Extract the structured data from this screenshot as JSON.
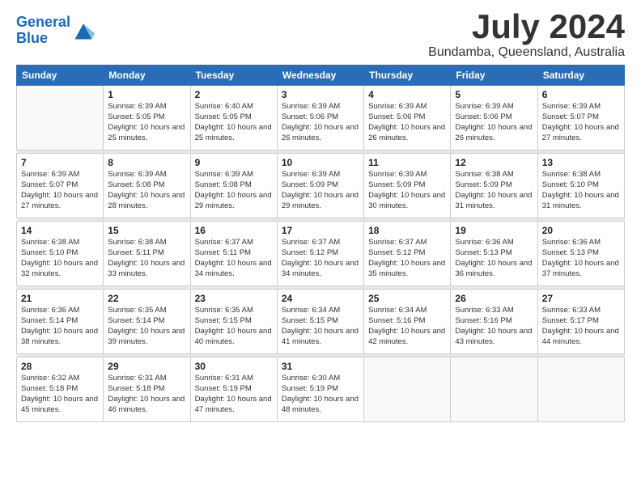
{
  "header": {
    "logo_line1": "General",
    "logo_line2": "Blue",
    "title": "July 2024",
    "subtitle": "Bundamba, Queensland, Australia"
  },
  "calendar": {
    "days": [
      "Sunday",
      "Monday",
      "Tuesday",
      "Wednesday",
      "Thursday",
      "Friday",
      "Saturday"
    ],
    "weeks": [
      [
        {
          "date": "",
          "info": ""
        },
        {
          "date": "1",
          "info": "Sunrise: 6:39 AM\nSunset: 5:05 PM\nDaylight: 10 hours\nand 25 minutes."
        },
        {
          "date": "2",
          "info": "Sunrise: 6:40 AM\nSunset: 5:05 PM\nDaylight: 10 hours\nand 25 minutes."
        },
        {
          "date": "3",
          "info": "Sunrise: 6:39 AM\nSunset: 5:06 PM\nDaylight: 10 hours\nand 26 minutes."
        },
        {
          "date": "4",
          "info": "Sunrise: 6:39 AM\nSunset: 5:06 PM\nDaylight: 10 hours\nand 26 minutes."
        },
        {
          "date": "5",
          "info": "Sunrise: 6:39 AM\nSunset: 5:06 PM\nDaylight: 10 hours\nand 26 minutes."
        },
        {
          "date": "6",
          "info": "Sunrise: 6:39 AM\nSunset: 5:07 PM\nDaylight: 10 hours\nand 27 minutes."
        }
      ],
      [
        {
          "date": "7",
          "info": "Sunrise: 6:39 AM\nSunset: 5:07 PM\nDaylight: 10 hours\nand 27 minutes."
        },
        {
          "date": "8",
          "info": "Sunrise: 6:39 AM\nSunset: 5:08 PM\nDaylight: 10 hours\nand 28 minutes."
        },
        {
          "date": "9",
          "info": "Sunrise: 6:39 AM\nSunset: 5:08 PM\nDaylight: 10 hours\nand 29 minutes."
        },
        {
          "date": "10",
          "info": "Sunrise: 6:39 AM\nSunset: 5:09 PM\nDaylight: 10 hours\nand 29 minutes."
        },
        {
          "date": "11",
          "info": "Sunrise: 6:39 AM\nSunset: 5:09 PM\nDaylight: 10 hours\nand 30 minutes."
        },
        {
          "date": "12",
          "info": "Sunrise: 6:38 AM\nSunset: 5:09 PM\nDaylight: 10 hours\nand 31 minutes."
        },
        {
          "date": "13",
          "info": "Sunrise: 6:38 AM\nSunset: 5:10 PM\nDaylight: 10 hours\nand 31 minutes."
        }
      ],
      [
        {
          "date": "14",
          "info": "Sunrise: 6:38 AM\nSunset: 5:10 PM\nDaylight: 10 hours\nand 32 minutes."
        },
        {
          "date": "15",
          "info": "Sunrise: 6:38 AM\nSunset: 5:11 PM\nDaylight: 10 hours\nand 33 minutes."
        },
        {
          "date": "16",
          "info": "Sunrise: 6:37 AM\nSunset: 5:11 PM\nDaylight: 10 hours\nand 34 minutes."
        },
        {
          "date": "17",
          "info": "Sunrise: 6:37 AM\nSunset: 5:12 PM\nDaylight: 10 hours\nand 34 minutes."
        },
        {
          "date": "18",
          "info": "Sunrise: 6:37 AM\nSunset: 5:12 PM\nDaylight: 10 hours\nand 35 minutes."
        },
        {
          "date": "19",
          "info": "Sunrise: 6:36 AM\nSunset: 5:13 PM\nDaylight: 10 hours\nand 36 minutes."
        },
        {
          "date": "20",
          "info": "Sunrise: 6:36 AM\nSunset: 5:13 PM\nDaylight: 10 hours\nand 37 minutes."
        }
      ],
      [
        {
          "date": "21",
          "info": "Sunrise: 6:36 AM\nSunset: 5:14 PM\nDaylight: 10 hours\nand 38 minutes."
        },
        {
          "date": "22",
          "info": "Sunrise: 6:35 AM\nSunset: 5:14 PM\nDaylight: 10 hours\nand 39 minutes."
        },
        {
          "date": "23",
          "info": "Sunrise: 6:35 AM\nSunset: 5:15 PM\nDaylight: 10 hours\nand 40 minutes."
        },
        {
          "date": "24",
          "info": "Sunrise: 6:34 AM\nSunset: 5:15 PM\nDaylight: 10 hours\nand 41 minutes."
        },
        {
          "date": "25",
          "info": "Sunrise: 6:34 AM\nSunset: 5:16 PM\nDaylight: 10 hours\nand 42 minutes."
        },
        {
          "date": "26",
          "info": "Sunrise: 6:33 AM\nSunset: 5:16 PM\nDaylight: 10 hours\nand 43 minutes."
        },
        {
          "date": "27",
          "info": "Sunrise: 6:33 AM\nSunset: 5:17 PM\nDaylight: 10 hours\nand 44 minutes."
        }
      ],
      [
        {
          "date": "28",
          "info": "Sunrise: 6:32 AM\nSunset: 5:18 PM\nDaylight: 10 hours\nand 45 minutes."
        },
        {
          "date": "29",
          "info": "Sunrise: 6:31 AM\nSunset: 5:18 PM\nDaylight: 10 hours\nand 46 minutes."
        },
        {
          "date": "30",
          "info": "Sunrise: 6:31 AM\nSunset: 5:19 PM\nDaylight: 10 hours\nand 47 minutes."
        },
        {
          "date": "31",
          "info": "Sunrise: 6:30 AM\nSunset: 5:19 PM\nDaylight: 10 hours\nand 48 minutes."
        },
        {
          "date": "",
          "info": ""
        },
        {
          "date": "",
          "info": ""
        },
        {
          "date": "",
          "info": ""
        }
      ]
    ]
  }
}
